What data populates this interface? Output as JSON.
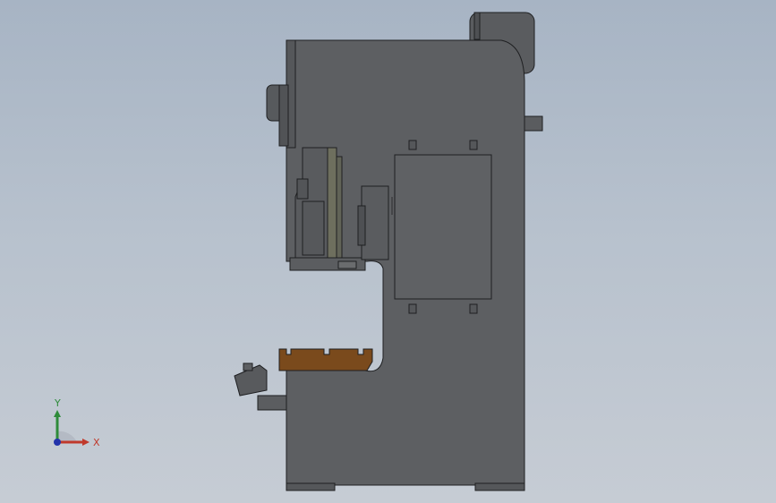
{
  "viewport": {
    "background_top": "#a7b4c4",
    "background_bottom": "#c6ccd4",
    "model_color": "#5d5f62",
    "model_edge_color": "#1e1f21",
    "bed_color": "#7a4a1c"
  },
  "triad": {
    "x_label": "X",
    "y_label": "Y",
    "x_color": "#c0392b",
    "y_color": "#2e8b3a",
    "z_color": "#2233aa"
  }
}
